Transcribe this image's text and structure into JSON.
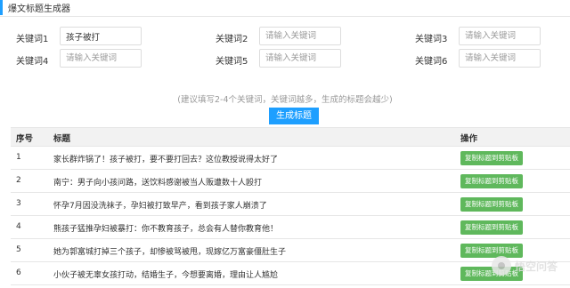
{
  "header": {
    "title": "爆文标题生成器"
  },
  "keywords": [
    {
      "label": "关键词1",
      "value": "孩子被打",
      "placeholder": "请输入关键词"
    },
    {
      "label": "关键词2",
      "value": "",
      "placeholder": "请输入关键词"
    },
    {
      "label": "关键词3",
      "value": "",
      "placeholder": "请输入关键词"
    },
    {
      "label": "关键词4",
      "value": "",
      "placeholder": "请输入关键词"
    },
    {
      "label": "关键词5",
      "value": "",
      "placeholder": "请输入关键词"
    },
    {
      "label": "关键词6",
      "value": "",
      "placeholder": "请输入关键词"
    }
  ],
  "hint": "(建议填写2-4个关键词，关键词越多，生成的标题会越少)",
  "generate_button": "生成标题",
  "table": {
    "headers": {
      "index": "序号",
      "title": "标题",
      "action": "操作"
    },
    "copy_label": "复制标题到剪贴板",
    "rows": [
      {
        "index": "1",
        "title": "家长群炸锅了！孩子被打，要不要打回去？这位教授说得太好了"
      },
      {
        "index": "2",
        "title": "南宁：男子向小孩问路，送饮料感谢被当人贩遭数十人殴打"
      },
      {
        "index": "3",
        "title": "怀孕7月因没洗袜子，孕妇被打致早产，看到孩子家人崩溃了"
      },
      {
        "index": "4",
        "title": "熊孩子猛推孕妇被暴打：你不教育孩子，总会有人替你教育他！"
      },
      {
        "index": "5",
        "title": "她为郭富城打掉三个孩子，却惨被骂被甩，现嫁亿万富豪僵肚生子"
      },
      {
        "index": "6",
        "title": "小伙子被无辜女孩打动，结婚生子，今想要离婚，理由让人尴尬"
      }
    ]
  },
  "watermark": {
    "text": "悟空问答"
  }
}
